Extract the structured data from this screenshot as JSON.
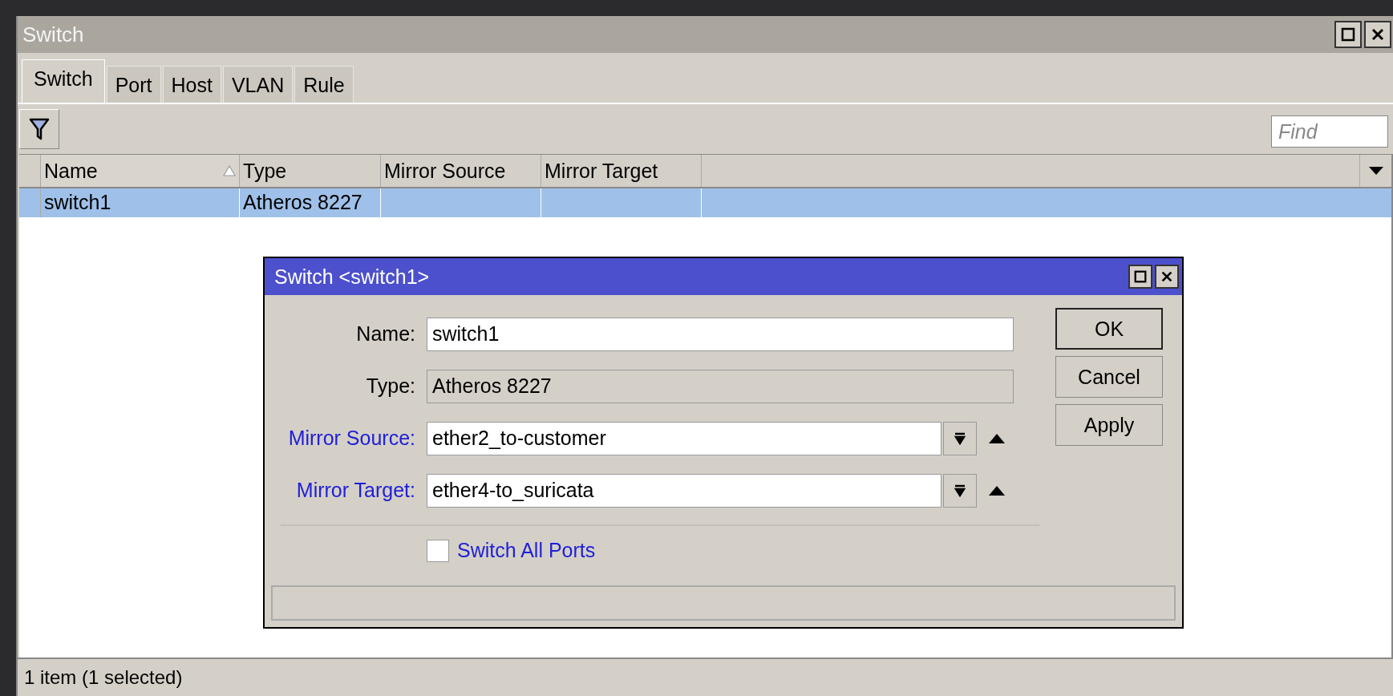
{
  "window": {
    "title": "Switch"
  },
  "tabs": [
    {
      "label": "Switch",
      "selected": true
    },
    {
      "label": "Port",
      "selected": false
    },
    {
      "label": "Host",
      "selected": false
    },
    {
      "label": "VLAN",
      "selected": false
    },
    {
      "label": "Rule",
      "selected": false
    }
  ],
  "search": {
    "placeholder": "Find"
  },
  "table": {
    "columns": [
      {
        "label": "Name",
        "sorted": true
      },
      {
        "label": "Type",
        "sorted": false
      },
      {
        "label": "Mirror Source",
        "sorted": false
      },
      {
        "label": "Mirror Target",
        "sorted": false
      }
    ],
    "rows": [
      {
        "cells": [
          "switch1",
          "Atheros 8227",
          "",
          ""
        ],
        "selected": true
      }
    ]
  },
  "status_bar": "1 item (1 selected)",
  "dialog": {
    "title": "Switch <switch1>",
    "fields": [
      {
        "kind": "text",
        "label": "Name:",
        "value": "switch1"
      },
      {
        "kind": "readonly",
        "label": "Type:",
        "value": "Atheros 8227"
      },
      {
        "kind": "combo",
        "label": "Mirror Source:",
        "value": "ether2_to-customer"
      },
      {
        "kind": "combo",
        "label": "Mirror Target:",
        "value": "ether4-to_suricata"
      }
    ],
    "checkbox": {
      "label": "Switch All Ports",
      "checked": false
    },
    "buttons": [
      {
        "label": "OK",
        "default": true
      },
      {
        "label": "Cancel",
        "default": false
      },
      {
        "label": "Apply",
        "default": false
      }
    ]
  }
}
